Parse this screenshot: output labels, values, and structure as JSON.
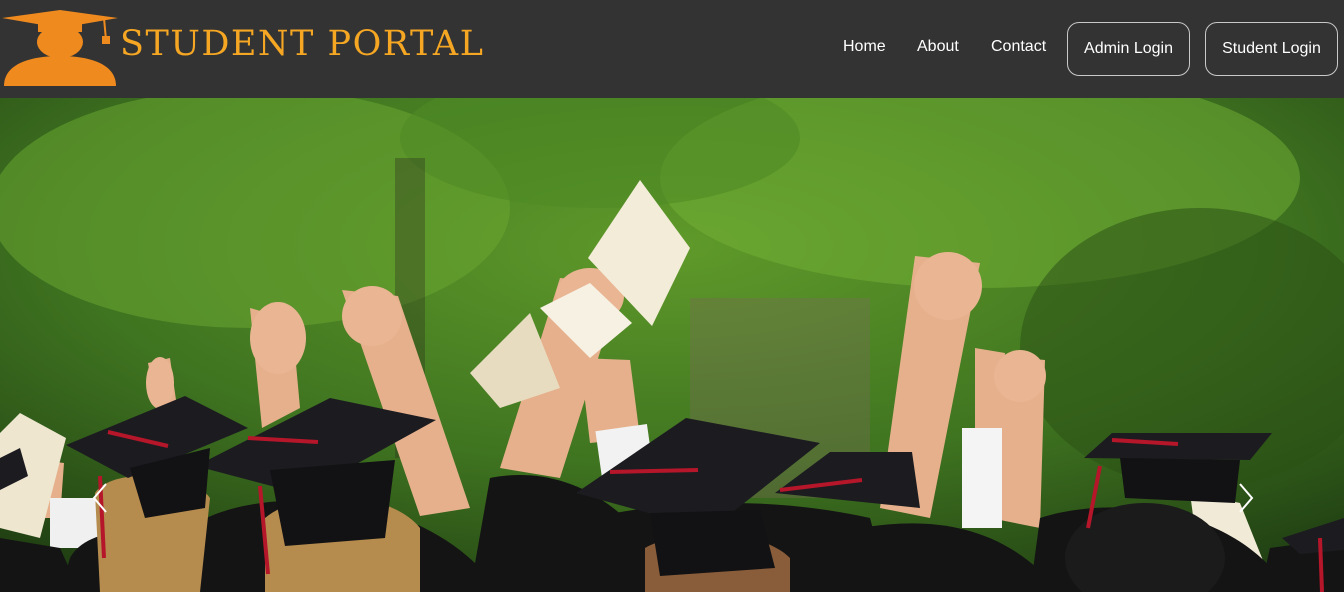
{
  "brand": {
    "name": "STUDENT PORTAL",
    "logo_icon": "graduate-cap-icon",
    "accent_color": "#f5a623",
    "logo_color": "#ef8a1e"
  },
  "nav": {
    "background": "#333333",
    "links": [
      {
        "label": "Home"
      },
      {
        "label": "About"
      },
      {
        "label": "Contact"
      }
    ],
    "buttons": [
      {
        "label": "Admin Login"
      },
      {
        "label": "Student Login"
      }
    ]
  },
  "hero": {
    "image_description": "graduates-in-caps-and-gowns-celebrating",
    "prev_icon": "chevron-left-icon",
    "next_icon": "chevron-right-icon"
  }
}
